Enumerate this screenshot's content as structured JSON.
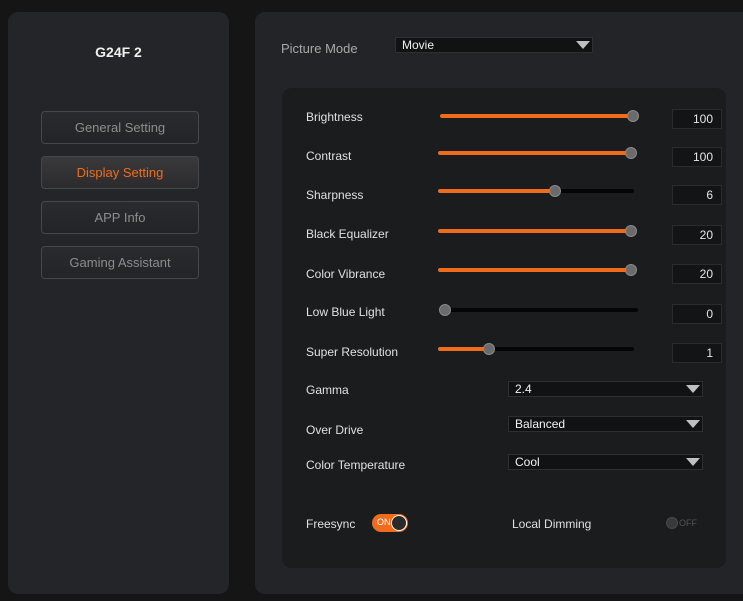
{
  "sidebar": {
    "device_name": "G24F 2",
    "items": [
      {
        "label": "General Setting"
      },
      {
        "label": "Display Setting"
      },
      {
        "label": "APP Info"
      },
      {
        "label": "Gaming Assistant"
      }
    ]
  },
  "picture_mode": {
    "label": "Picture Mode",
    "value": "Movie"
  },
  "sliders": [
    {
      "label": "Brightness",
      "value": "100",
      "level": 1.0
    },
    {
      "label": "Contrast",
      "value": "100",
      "level": 1.0
    },
    {
      "label": "Sharpness",
      "value": "6",
      "level": 0.6
    },
    {
      "label": "Black Equalizer",
      "value": "20",
      "level": 1.0
    },
    {
      "label": "Color Vibrance",
      "value": "20",
      "level": 1.0
    },
    {
      "label": "Low Blue Light",
      "value": "0",
      "level": 0.0
    },
    {
      "label": "Super Resolution",
      "value": "1",
      "level": 0.25
    }
  ],
  "selects": [
    {
      "label": "Gamma",
      "value": "2.4"
    },
    {
      "label": "Over Drive",
      "value": "Balanced"
    },
    {
      "label": "Color Temperature",
      "value": "Cool"
    }
  ],
  "freesync": {
    "label": "Freesync",
    "state": "ON"
  },
  "local_dimming": {
    "label": "Local Dimming",
    "state": "OFF"
  },
  "colors": {
    "accent": "#f06b1b",
    "panel": "#1b1c1e",
    "background": "#151515"
  }
}
